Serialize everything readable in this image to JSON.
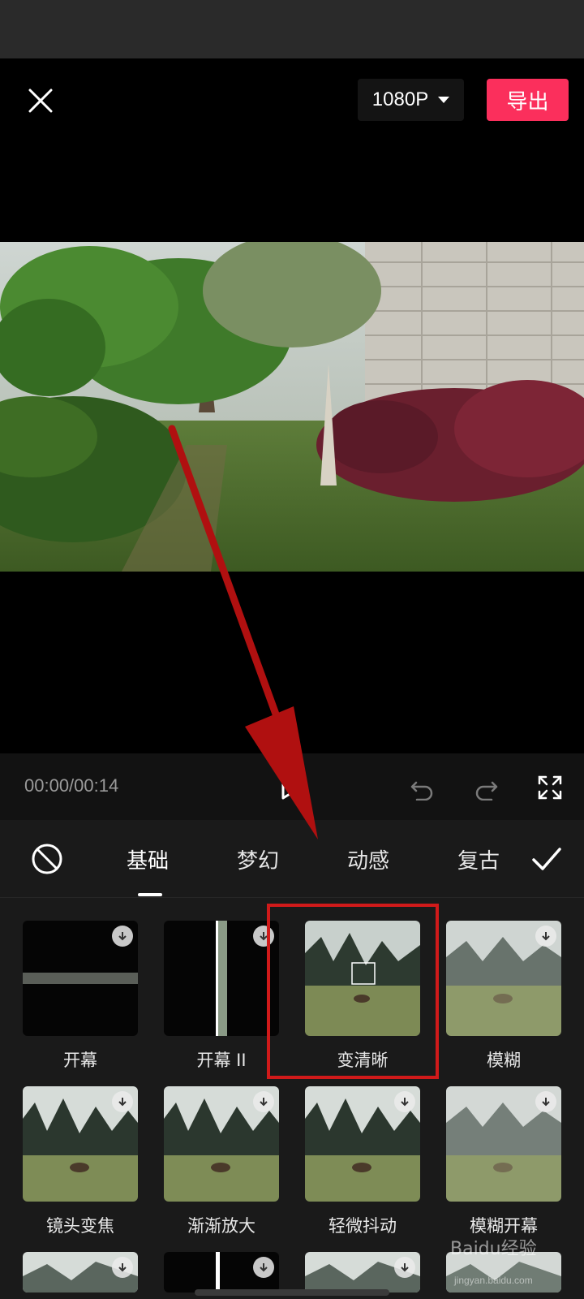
{
  "header": {
    "resolution": "1080P",
    "export_label": "导出"
  },
  "player": {
    "timecode": "00:00/00:14"
  },
  "tabs": [
    {
      "label": "基础",
      "active": true
    },
    {
      "label": "梦幻",
      "active": false
    },
    {
      "label": "动感",
      "active": false
    },
    {
      "label": "复古",
      "active": false
    }
  ],
  "effects": [
    {
      "label": "开幕",
      "downloadable": true
    },
    {
      "label": "开幕 II",
      "downloadable": true
    },
    {
      "label": "变清晰",
      "downloadable": false,
      "highlighted": true
    },
    {
      "label": "模糊",
      "downloadable": true
    },
    {
      "label": "镜头变焦",
      "downloadable": true
    },
    {
      "label": "渐渐放大",
      "downloadable": true
    },
    {
      "label": "轻微抖动",
      "downloadable": true
    },
    {
      "label": "模糊开幕",
      "downloadable": true
    }
  ],
  "watermark": {
    "brand": "Baidu经验",
    "url": "jingyan.baidu.com"
  },
  "colors": {
    "accent": "#fb2f5c",
    "annotation": "#d01a1a"
  }
}
